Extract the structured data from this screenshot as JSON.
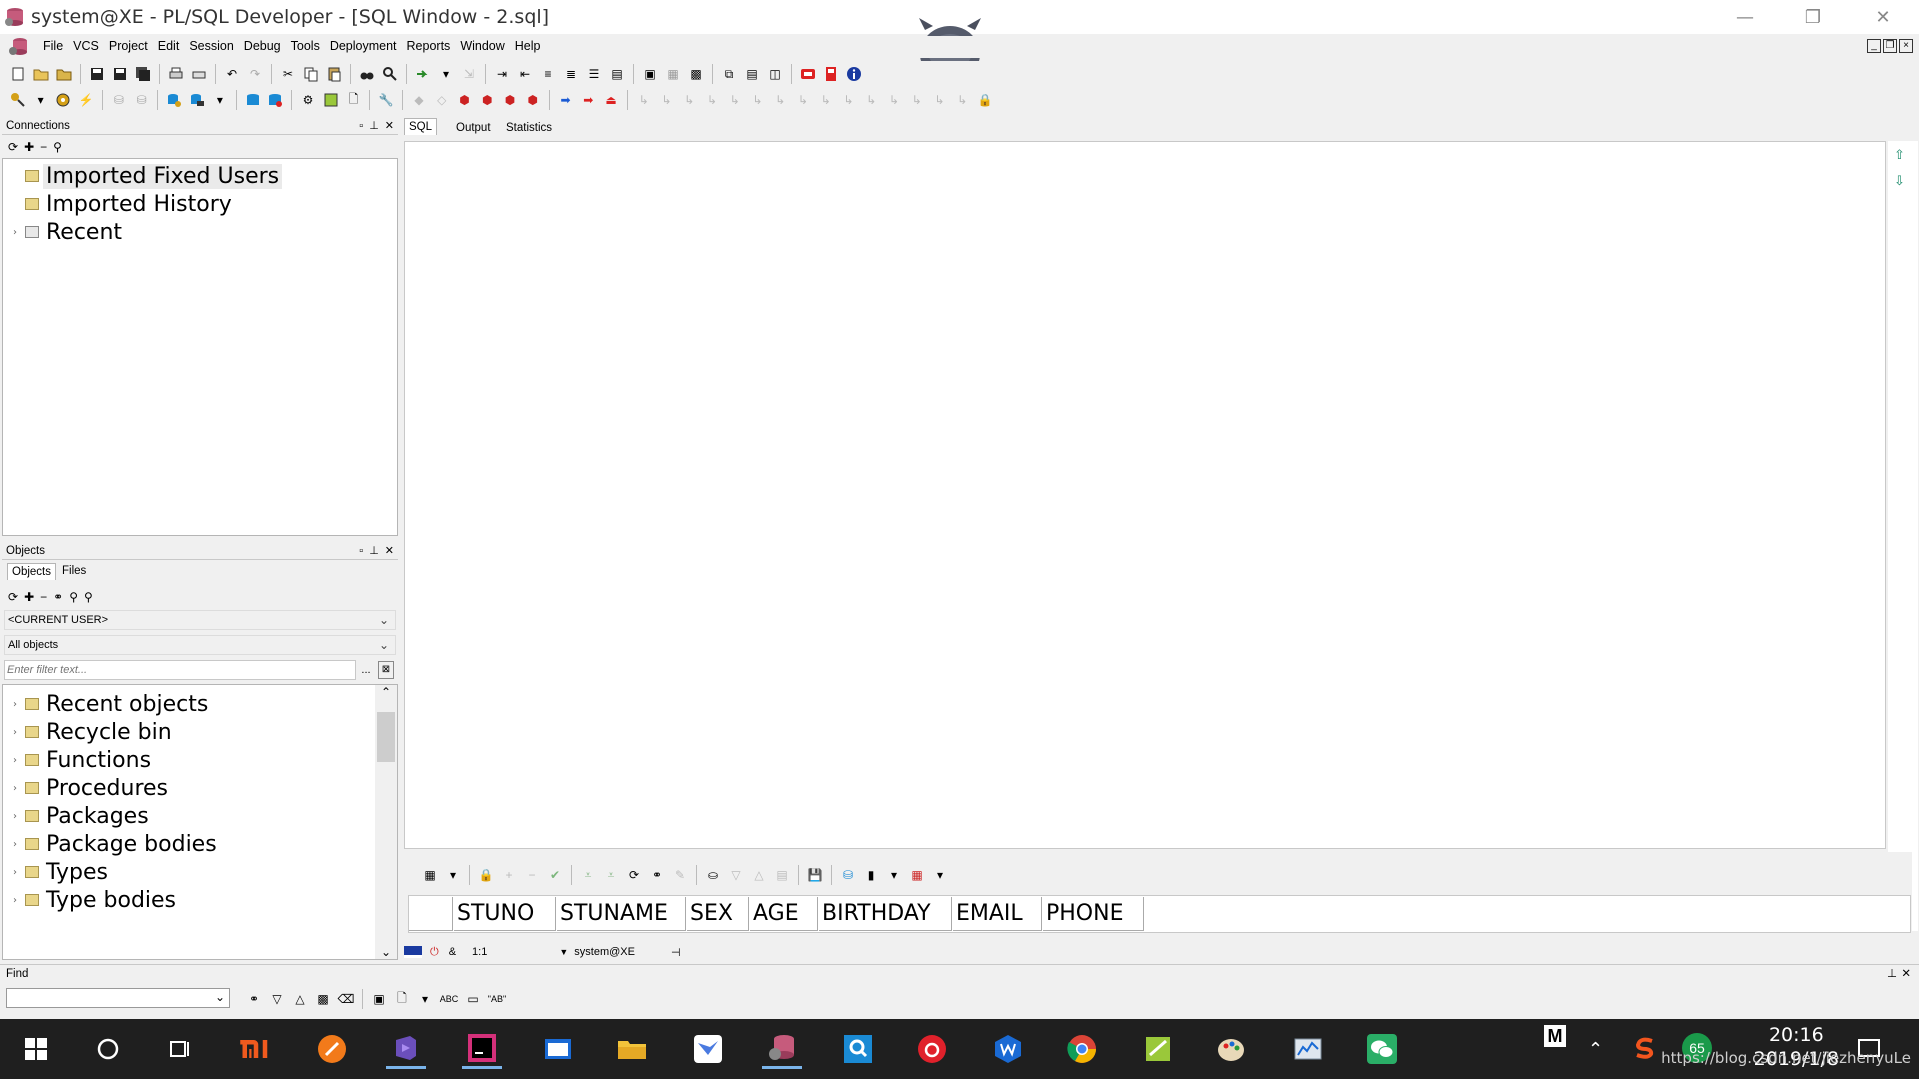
{
  "window": {
    "title": "system@XE - PL/SQL Developer - [SQL Window - 2.sql]",
    "minimize": "—",
    "restore": "❐",
    "close": "✕"
  },
  "menu": {
    "items": [
      "File",
      "VCS",
      "Project",
      "Edit",
      "Session",
      "Debug",
      "Tools",
      "Deployment",
      "Reports",
      "Window",
      "Help"
    ]
  },
  "connections": {
    "title": "Connections",
    "tree": [
      {
        "label": "Imported Fixed Users",
        "selected": true
      },
      {
        "label": "Imported History",
        "selected": false
      },
      {
        "label": "Recent",
        "selected": false
      }
    ]
  },
  "objects": {
    "title": "Objects",
    "tabs": [
      "Objects",
      "Files"
    ],
    "user_select": "<CURRENT USER>",
    "filter_select": "All objects",
    "filter_placeholder": "Enter filter text...",
    "filter_button": "...",
    "tree": [
      "Recent objects",
      "Recycle bin",
      "Functions",
      "Procedures",
      "Packages",
      "Package bodies",
      "Types",
      "Type bodies"
    ]
  },
  "editor": {
    "tabs": [
      "SQL",
      "Output",
      "Statistics"
    ],
    "active_tab": "SQL"
  },
  "grid": {
    "columns": [
      "STUNO",
      "STUNAME",
      "SEX",
      "AGE",
      "BIRTHDAY",
      "EMAIL",
      "PHONE"
    ]
  },
  "status": {
    "position": "1:1",
    "connection": "system@XE"
  },
  "find": {
    "label": "Find",
    "abc": "ABC",
    "ab_quoted": "\"AB\""
  },
  "taskbar": {
    "time": "20:16",
    "date": "2019/1/8",
    "badge": "65",
    "watermark": "https://blog.csdn.net/jiezhenyuLe",
    "ime": "M"
  },
  "colors": {
    "taskbar_bg": "#1f1f1f",
    "folder": "#e9d68a"
  }
}
